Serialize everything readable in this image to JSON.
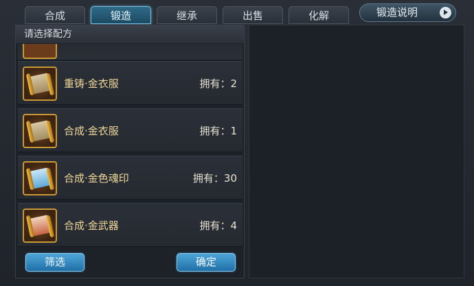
{
  "tabs": [
    {
      "label": "合成",
      "active": false
    },
    {
      "label": "锻造",
      "active": true
    },
    {
      "label": "继承",
      "active": false
    },
    {
      "label": "出售",
      "active": false
    },
    {
      "label": "化解",
      "active": false
    }
  ],
  "help_button": {
    "label": "锻造说明",
    "icon": "play-arrow-icon"
  },
  "recipe_panel": {
    "title": "请选择配方",
    "recipes": [
      {
        "name": "重铸·金衣服",
        "owned": "拥有：2",
        "icon": "gold-scroll-icon"
      },
      {
        "name": "合成·金衣服",
        "owned": "拥有：1",
        "icon": "gold-scroll-icon"
      },
      {
        "name": "合成·金色魂印",
        "owned": "拥有：30",
        "icon": "blue-scroll-icon"
      },
      {
        "name": "合成·金武器",
        "owned": "拥有：4",
        "icon": "red-scroll-icon"
      }
    ]
  },
  "actions": {
    "filter_label": "筛选",
    "confirm_label": "确定"
  },
  "colors": {
    "accent": "#2f6a86",
    "button": "#2f86c0",
    "recipe_name": "#f0d89a",
    "item_border": "#c99a36"
  }
}
